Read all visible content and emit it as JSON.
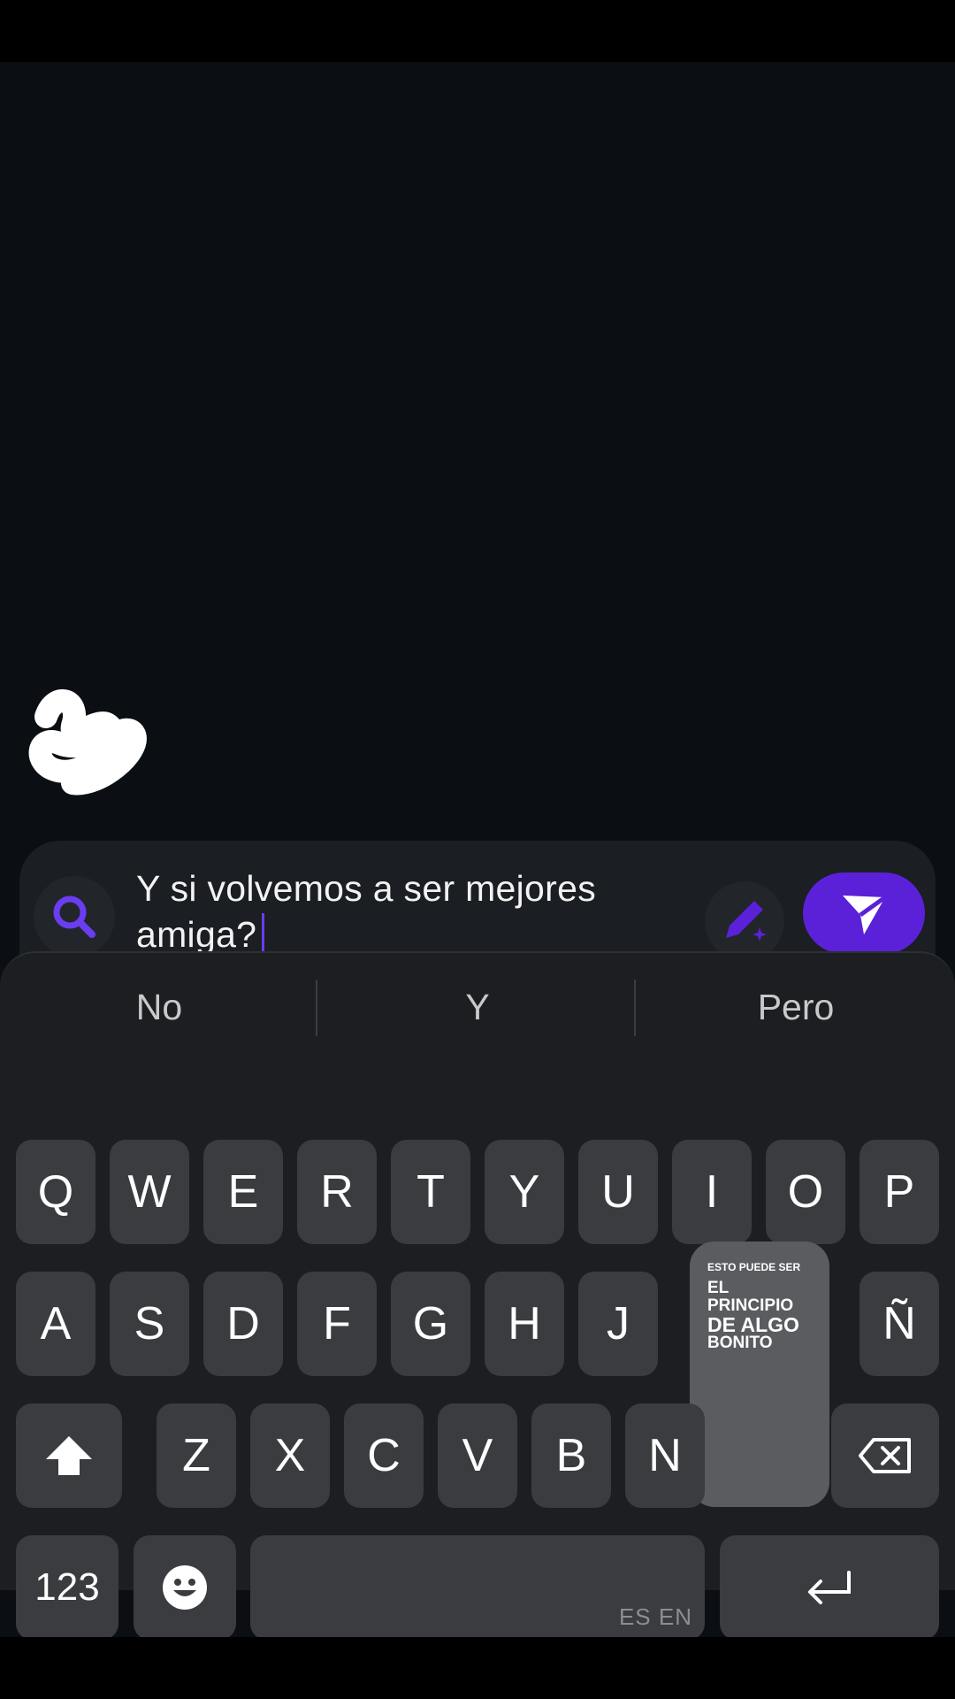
{
  "composer": {
    "message_line1": "Y si volvemos a ser mejores",
    "message_line2": "amiga?"
  },
  "suggestions": [
    "No",
    "Y",
    "Pero"
  ],
  "keyboard": {
    "row1": [
      "Q",
      "W",
      "E",
      "R",
      "T",
      "Y",
      "U",
      "I",
      "O",
      "P"
    ],
    "row2": [
      "A",
      "S",
      "D",
      "F",
      "G",
      "H",
      "J",
      "Ñ"
    ],
    "row3": [
      "Z",
      "X",
      "C",
      "V",
      "B",
      "N"
    ],
    "numbers_label": "123",
    "space_lang_label": "ES EN"
  },
  "popup": {
    "line1": "ESTO PUEDE SER",
    "line2": "EL",
    "line3": "PRINCIPIO",
    "line4": "DE ALGO",
    "line5": "BONITO"
  },
  "colors": {
    "accent": "#5b21d8",
    "search_icon": "#6a3df0",
    "background": "#0b0f14",
    "key": "#3a3c40"
  },
  "icons": {
    "search": "search-icon",
    "edit": "pen-sparkle-icon",
    "send": "send-icon",
    "shift": "shift-arrow-icon",
    "backspace": "backspace-icon",
    "emoji": "emoji-icon",
    "enter": "enter-icon"
  }
}
